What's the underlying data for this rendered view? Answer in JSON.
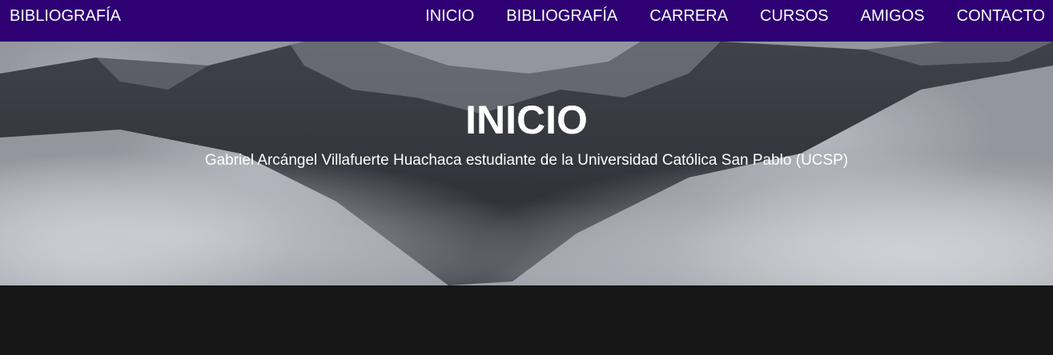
{
  "navbar": {
    "brand": "BIBLIOGRAFÍA",
    "links": [
      {
        "label": "INICIO"
      },
      {
        "label": "BIBLIOGRAFÍA"
      },
      {
        "label": "CARRERA"
      },
      {
        "label": "CURSOS"
      },
      {
        "label": "AMIGOS"
      },
      {
        "label": "CONTACTO"
      }
    ],
    "background_color": "#2e0073"
  },
  "hero": {
    "title": "INICIO",
    "subtitle": "Gabriel Arcángel Villafuerte Huachaca estudiante de la Universidad Católica San Pablo (UCSP)",
    "image_description": "misty-snowy-mountain-background"
  }
}
